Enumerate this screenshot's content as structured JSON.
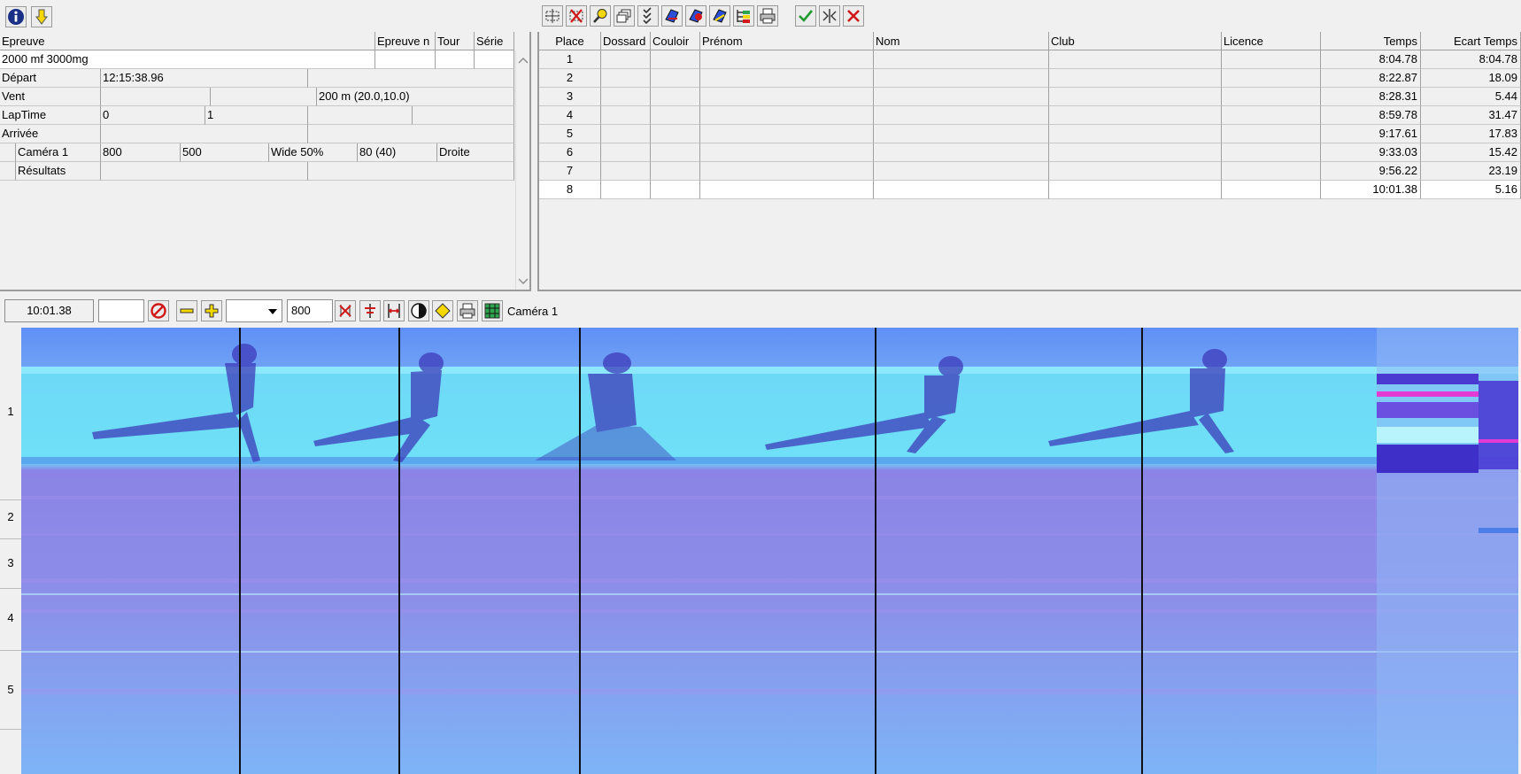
{
  "left_toolbar": {
    "info_icon": "info-icon",
    "download_icon": "arrow-down-icon"
  },
  "event_grid": {
    "headers": [
      "Epreuve",
      "Epreuve n",
      "Tour",
      "Série"
    ],
    "event_name": "2000 mf 3000mg",
    "rows": [
      {
        "label": "Départ",
        "v1": "12:15:38.96",
        "v2": ""
      },
      {
        "label": "Vent",
        "v1": "",
        "v2": "200 m (20.0,10.0)"
      },
      {
        "label": "LapTime",
        "v1": "0",
        "v2": "1"
      },
      {
        "label": "Arrivée",
        "v1": "",
        "v2": ""
      }
    ],
    "camera": {
      "label": "Caméra 1",
      "c1": "800",
      "c2": "500",
      "c3": "Wide 50%",
      "c4": "80  (40)",
      "c5": "Droite"
    },
    "results_label": "Résultats"
  },
  "results_grid": {
    "headers": {
      "place": "Place",
      "dossard": "Dossard",
      "couloir": "Couloir",
      "prenom": "Prénom",
      "nom": "Nom",
      "club": "Club",
      "licence": "Licence",
      "temps": "Temps",
      "ecart": "Ecart Temps"
    },
    "rows": [
      {
        "place": "1",
        "temps": "8:04.78",
        "ecart": "8:04.78"
      },
      {
        "place": "2",
        "temps": "8:22.87",
        "ecart": "18.09"
      },
      {
        "place": "3",
        "temps": "8:28.31",
        "ecart": "5.44"
      },
      {
        "place": "4",
        "temps": "8:59.78",
        "ecart": "31.47"
      },
      {
        "place": "5",
        "temps": "9:17.61",
        "ecart": "17.83"
      },
      {
        "place": "6",
        "temps": "9:33.03",
        "ecart": "15.42"
      },
      {
        "place": "7",
        "temps": "9:56.22",
        "ecart": "23.19"
      },
      {
        "place": "8",
        "temps": "10:01.38",
        "ecart": "5.16"
      }
    ]
  },
  "photo_toolbar": {
    "time": "10:01.38",
    "field1": "",
    "zoom_select": "",
    "width": "800",
    "camera": "Caméra 1"
  },
  "lanes": [
    "1",
    "2",
    "3",
    "4",
    "5"
  ],
  "colors": {
    "photo_blue": "#7aa6f6",
    "photo_purple": "#8a7fe6",
    "photo_cyan": "#6fe6f8",
    "accent_red": "#d01818"
  }
}
